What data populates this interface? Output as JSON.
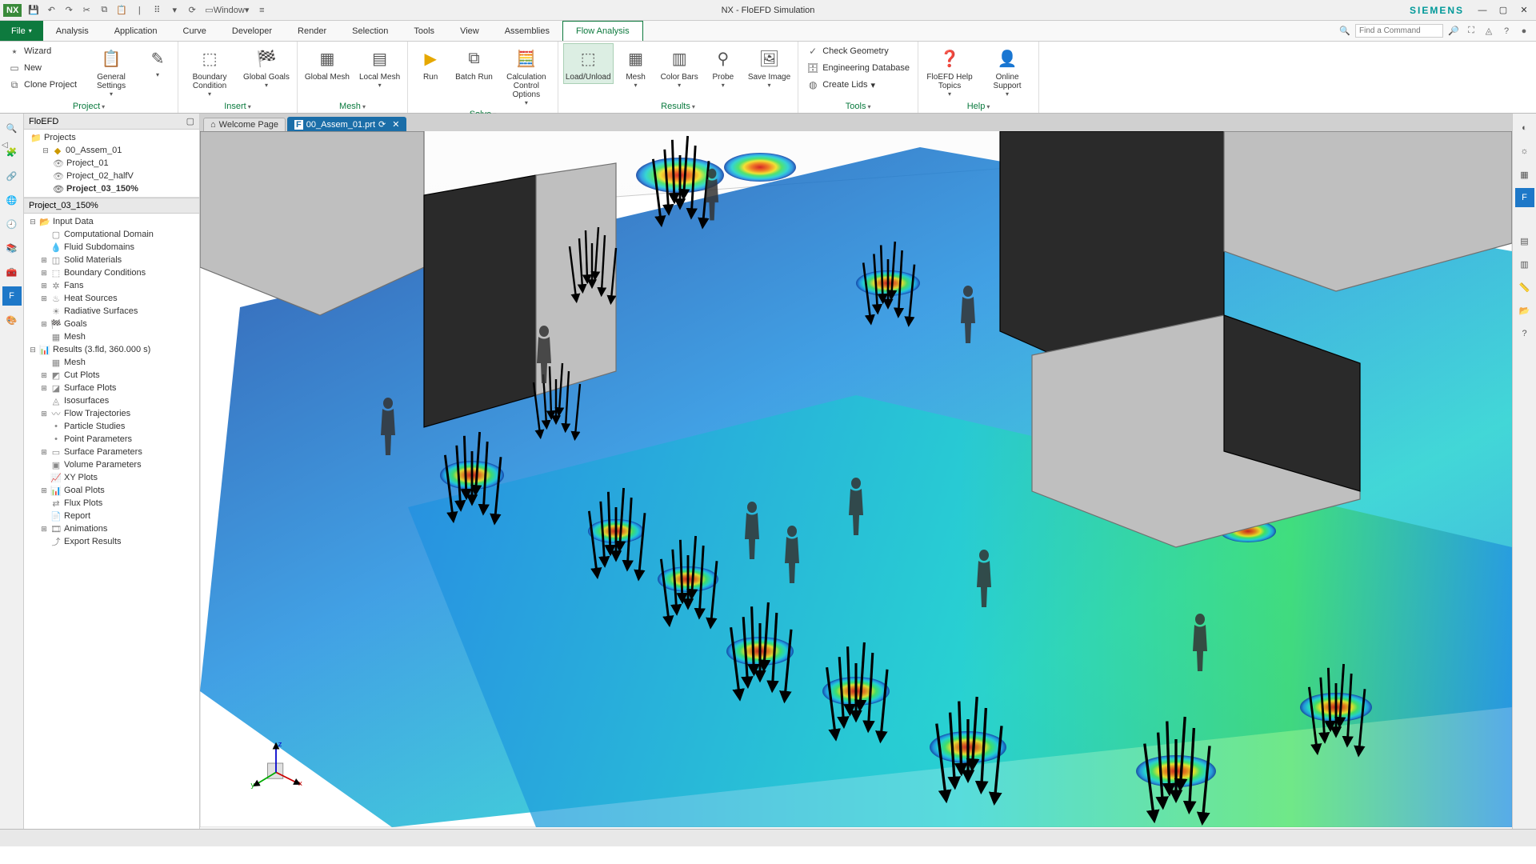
{
  "title": "NX - FloEFD Simulation",
  "brand": "SIEMENS",
  "logo": "NX",
  "qat": {
    "window_label": "Window"
  },
  "menu": {
    "items": [
      "File",
      "Analysis",
      "Application",
      "Curve",
      "Developer",
      "Render",
      "Selection",
      "Tools",
      "View",
      "Assemblies",
      "Flow Analysis"
    ],
    "active": "Flow Analysis",
    "search_placeholder": "Find a Command"
  },
  "ribbon": {
    "groups": {
      "project": {
        "label": "Project",
        "wizard": "Wizard",
        "new": "New",
        "clone": "Clone Project",
        "general": "General\nSettings"
      },
      "insert": {
        "label": "Insert",
        "boundary": "Boundary\nCondition",
        "goals": "Global\nGoals"
      },
      "mesh": {
        "label": "Mesh",
        "gmesh": "Global\nMesh",
        "lmesh": "Local\nMesh"
      },
      "solve": {
        "label": "Solve",
        "run": "Run",
        "batch": "Batch\nRun",
        "calc": "Calculation\nControl Options"
      },
      "results": {
        "label": "Results",
        "load": "Load/Unload",
        "mesh": "Mesh",
        "cbars": "Color\nBars",
        "probe": "Probe",
        "save": "Save\nImage"
      },
      "tools": {
        "label": "Tools",
        "check": "Check Geometry",
        "engdb": "Engineering Database",
        "lids": "Create Lids"
      },
      "help": {
        "label": "Help",
        "helptop": "FloEFD Help\nTopics",
        "online": "Online\nSupport"
      }
    }
  },
  "docs": {
    "welcome": "Welcome Page",
    "active": "00_Assem_01.prt"
  },
  "sidepanel": {
    "title": "FloEFD",
    "projects_label": "Projects",
    "assembly": "00_Assem_01",
    "projects": [
      "Project_01",
      "Project_02_halfV",
      "Project_03_150%"
    ],
    "active_project": "Project_03_150%",
    "detail_label": "Project_03_150%",
    "input_label": "Input Data",
    "input_items": [
      "Computational Domain",
      "Fluid Subdomains",
      "Solid Materials",
      "Boundary Conditions",
      "Fans",
      "Heat Sources",
      "Radiative Surfaces",
      "Goals",
      "Mesh"
    ],
    "results_label": "Results (3.fld, 360.000 s)",
    "result_items": [
      "Mesh",
      "Cut Plots",
      "Surface Plots",
      "Isosurfaces",
      "Flow Trajectories",
      "Particle Studies",
      "Point Parameters",
      "Surface Parameters",
      "Volume Parameters",
      "XY Plots",
      "Goal Plots",
      "Flux Plots",
      "Report",
      "Animations",
      "Export Results"
    ]
  },
  "triad": {
    "x": "x",
    "y": "y",
    "z": "z"
  }
}
